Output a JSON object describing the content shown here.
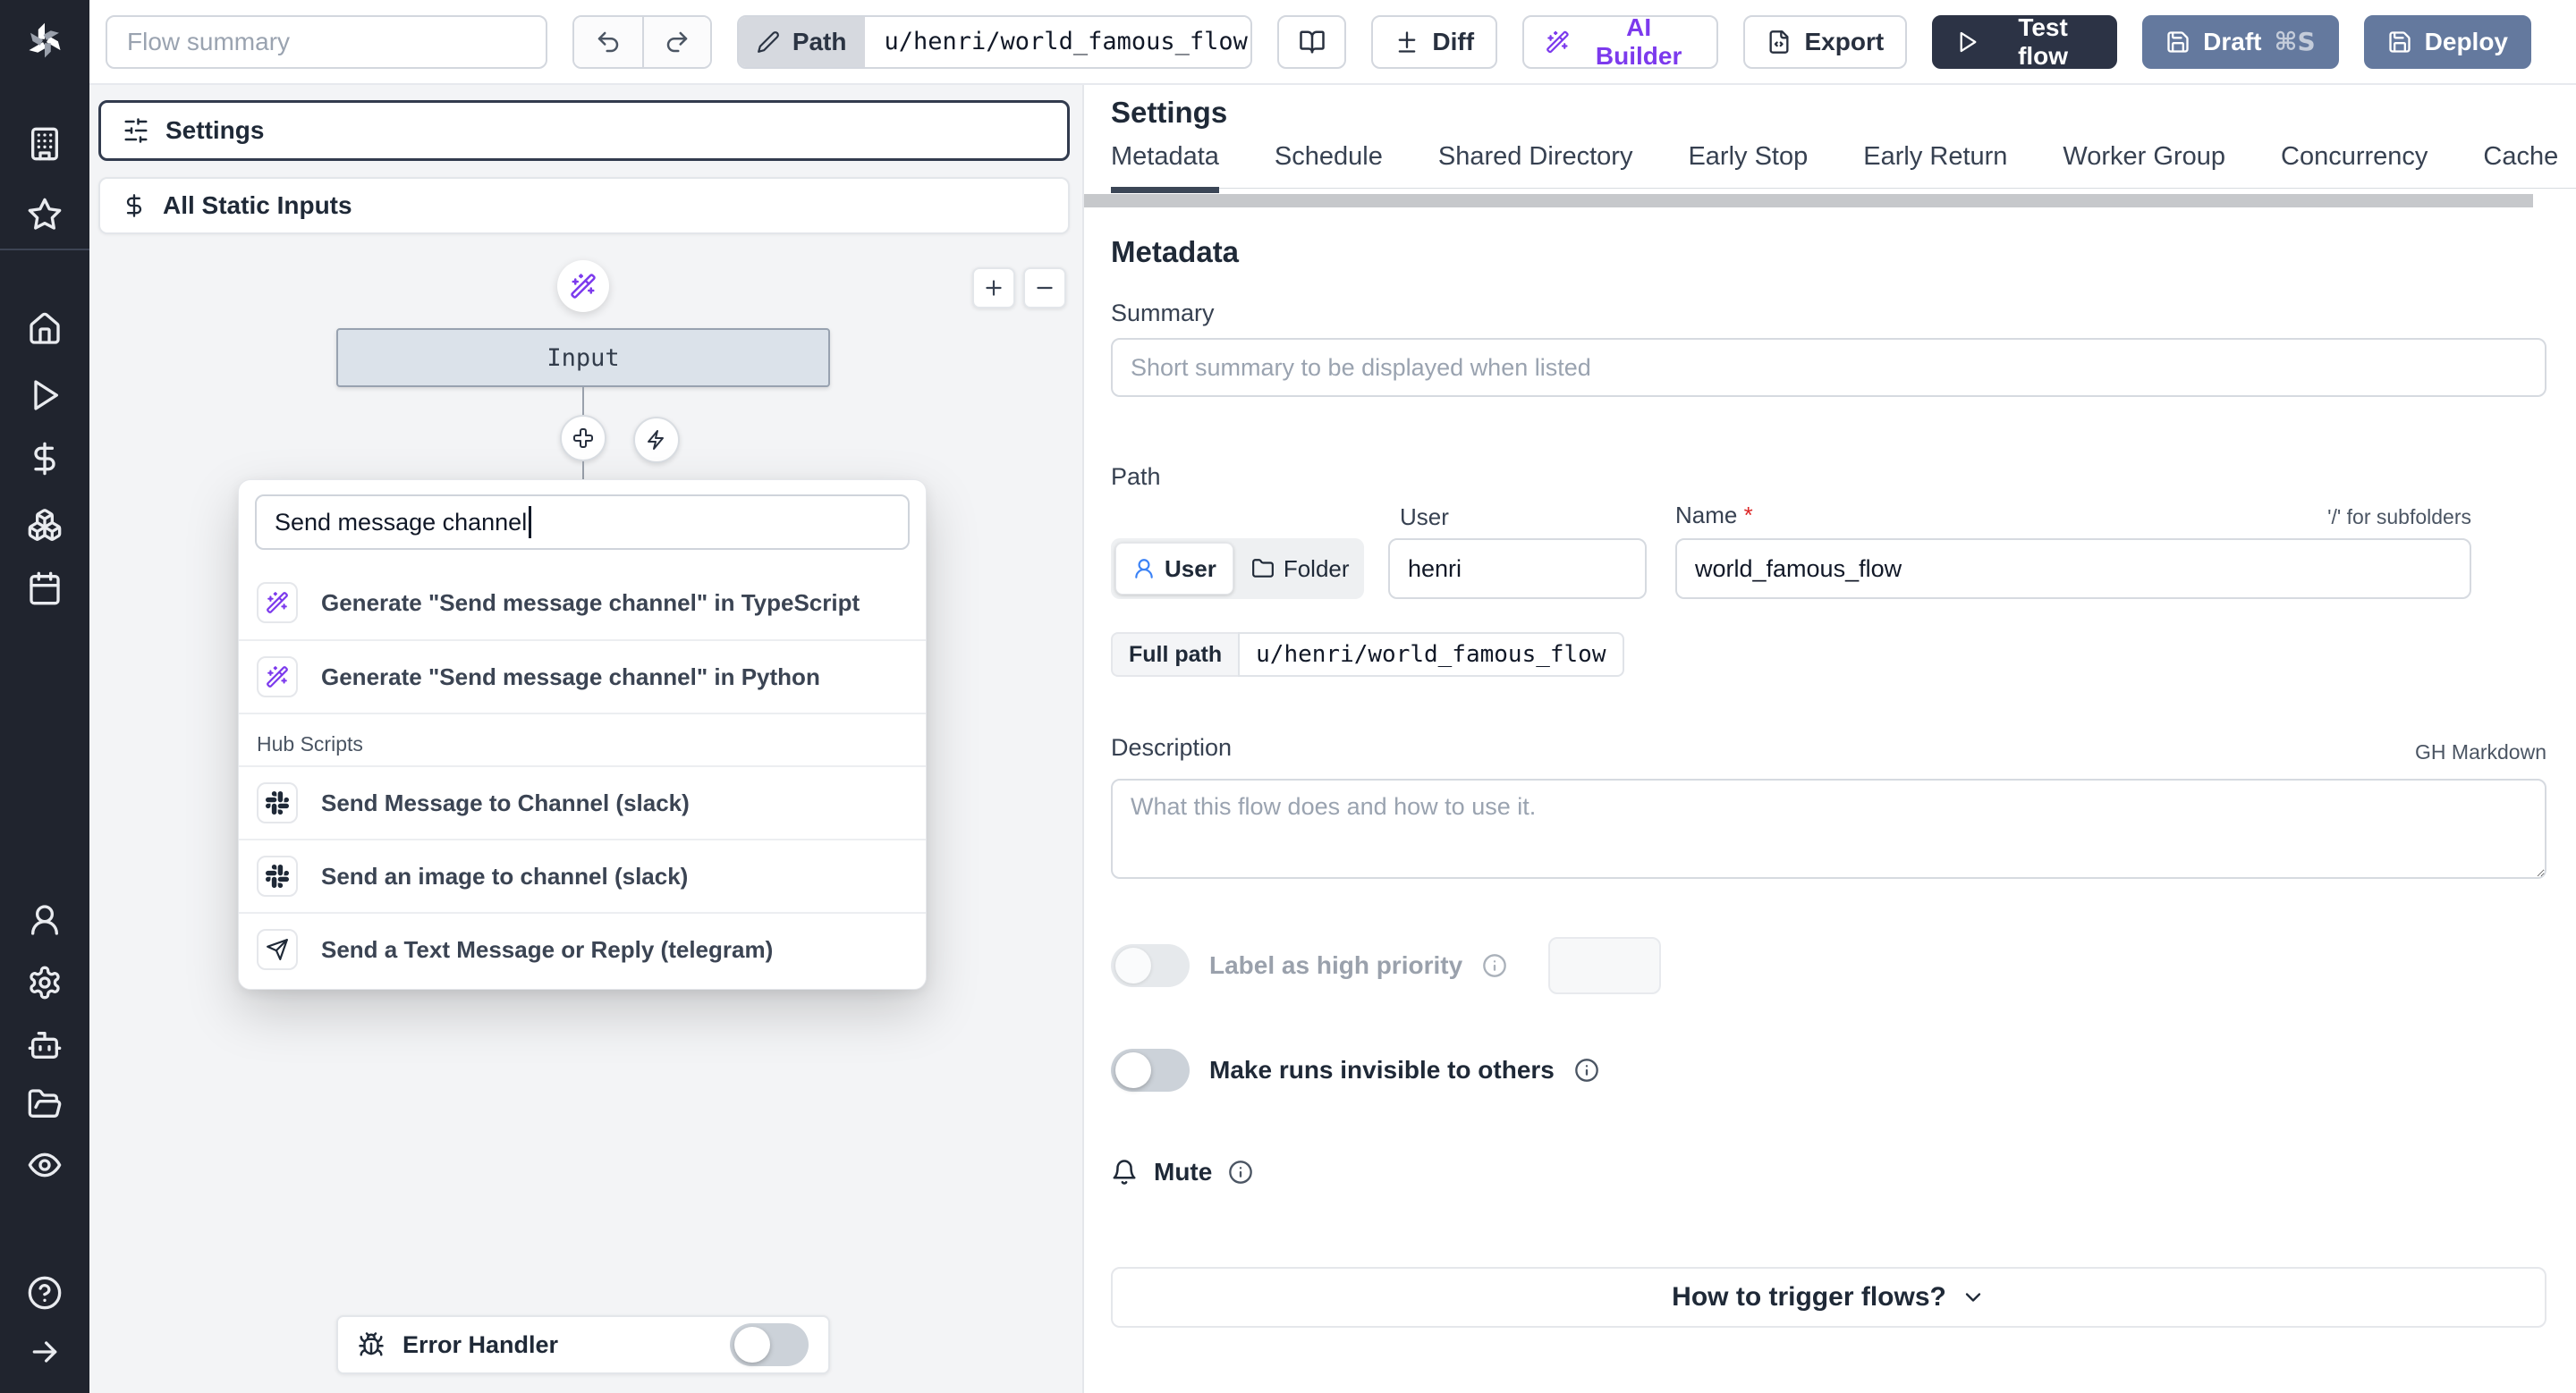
{
  "colors": {
    "sidebar_bg": "#20242e",
    "primary_dark": "#2c3345",
    "slate_button": "#64799e",
    "accent_purple": "#7c3aed",
    "canvas_bg": "#f3f4f6",
    "node_bg": "#dbe2ea",
    "user_blue": "#3b82f6",
    "required_red": "#dc2626"
  },
  "sidebar": {
    "icons": [
      "windmill-logo",
      "building",
      "star",
      "home",
      "play",
      "dollar-sign",
      "boxes",
      "calendar",
      "user",
      "settings-gear",
      "bot",
      "folder-open",
      "eye",
      "help-circle",
      "arrow-right"
    ]
  },
  "topbar": {
    "flow_summary_placeholder": "Flow summary",
    "path_label": "Path",
    "path_value": "u/henri/world_famous_flow",
    "diff_label": "Diff",
    "ai_builder_label": "AI Builder",
    "export_label": "Export",
    "test_flow_label": "Test flow",
    "draft_label": "Draft",
    "draft_shortcut": "⌘S",
    "deploy_label": "Deploy"
  },
  "flow_editor": {
    "settings_label": "Settings",
    "static_inputs_label": "All Static Inputs",
    "input_node_label": "Input",
    "error_handler_label": "Error Handler",
    "search_value": "Send message channel",
    "suggestions": [
      {
        "icon": "wand-sparkles",
        "label": "Generate \"Send message channel\" in TypeScript"
      },
      {
        "icon": "wand-sparkles",
        "label": "Generate \"Send message channel\" in Python"
      }
    ],
    "hub_section_label": "Hub Scripts",
    "hub_items": [
      {
        "icon": "slack",
        "label": "Send Message to Channel (slack)"
      },
      {
        "icon": "slack",
        "label": "Send an image to channel (slack)"
      },
      {
        "icon": "send-plane",
        "label": "Send a Text Message or Reply (telegram)"
      }
    ]
  },
  "settings_panel": {
    "title": "Settings",
    "active_tab": "Metadata",
    "tabs": [
      "Metadata",
      "Schedule",
      "Shared Directory",
      "Early Stop",
      "Early Return",
      "Worker Group",
      "Concurrency",
      "Cache"
    ],
    "metadata": {
      "heading": "Metadata",
      "summary_label": "Summary",
      "summary_placeholder": "Short summary to be displayed when listed",
      "path_label": "Path",
      "owner_toggle_user": "User",
      "owner_toggle_folder": "Folder",
      "user_label": "User",
      "user_value": "henri",
      "name_label": "Name",
      "required_marker": "*",
      "subfolder_hint": "'/' for subfolders",
      "full_path_label": "Full path",
      "full_path_value": "u/henri/world_famous_flow",
      "description_label": "Description",
      "markdown_hint": "GH Markdown",
      "description_placeholder": "What this flow does and how to use it.",
      "high_priority_label": "Label as high priority",
      "invisible_runs_label": "Make runs invisible to others",
      "mute_label": "Mute",
      "trigger_button_label": "How to trigger flows?"
    }
  }
}
